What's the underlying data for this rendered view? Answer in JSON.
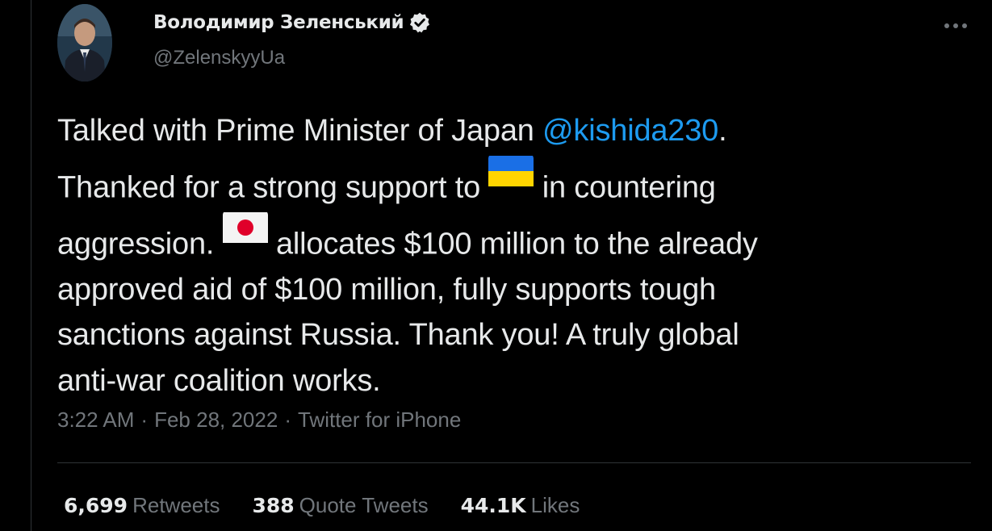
{
  "author": {
    "display_name": "Володимир Зеленський",
    "handle": "@ZelenskyyUa",
    "avatar_icon": "user-avatar",
    "verified_icon": "verified-badge-icon"
  },
  "tweet": {
    "text_line1_a": "Talked with Prime Minister of Japan ",
    "mention": "@kishida230",
    "text_line1_b": ".",
    "text_line2_a": "Thanked for a strong support to ",
    "flag_ukraine": "ukraine-flag-emoji",
    "text_line2_b": " in countering",
    "text_line3_a": "aggression. ",
    "flag_japan": "japan-flag-emoji",
    "text_line3_b": " allocates $100 million to the already",
    "text_line4": "approved aid of $100 million, fully supports tough",
    "text_line5": "sanctions against Russia. Thank you! A truly global",
    "text_line6": "anti-war coalition works."
  },
  "meta": {
    "time": "3:22 AM",
    "separator": "·",
    "date": "Feb 28, 2022",
    "source": "Twitter for iPhone"
  },
  "stats": {
    "retweets_count": "6,699",
    "retweets_label": "Retweets",
    "quotes_count": "388",
    "quotes_label": "Quote Tweets",
    "likes_count": "44.1K",
    "likes_label": "Likes"
  },
  "colors": {
    "background": "#000000",
    "text": "#e7e9ea",
    "muted": "#71767b",
    "accent": "#1d9bf0",
    "border": "#2f3336"
  }
}
